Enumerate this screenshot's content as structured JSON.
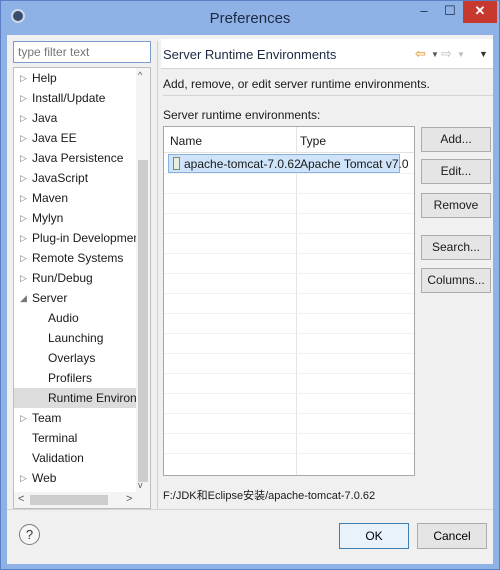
{
  "window": {
    "title": "Preferences",
    "minimize": "–",
    "maximize": "☐",
    "close": "✕"
  },
  "filter": {
    "placeholder": "type filter text"
  },
  "tree": [
    {
      "label": "Help",
      "arrow": "▷",
      "child": false
    },
    {
      "label": "Install/Update",
      "arrow": "▷",
      "child": false
    },
    {
      "label": "Java",
      "arrow": "▷",
      "child": false
    },
    {
      "label": "Java EE",
      "arrow": "▷",
      "child": false
    },
    {
      "label": "Java Persistence",
      "arrow": "▷",
      "child": false
    },
    {
      "label": "JavaScript",
      "arrow": "▷",
      "child": false
    },
    {
      "label": "Maven",
      "arrow": "▷",
      "child": false
    },
    {
      "label": "Mylyn",
      "arrow": "▷",
      "child": false
    },
    {
      "label": "Plug-in Development",
      "arrow": "▷",
      "child": false
    },
    {
      "label": "Remote Systems",
      "arrow": "▷",
      "child": false
    },
    {
      "label": "Run/Debug",
      "arrow": "▷",
      "child": false
    },
    {
      "label": "Server",
      "arrow": "◢",
      "child": false
    },
    {
      "label": "Audio",
      "arrow": "",
      "child": true
    },
    {
      "label": "Launching",
      "arrow": "",
      "child": true
    },
    {
      "label": "Overlays",
      "arrow": "",
      "child": true
    },
    {
      "label": "Profilers",
      "arrow": "",
      "child": true
    },
    {
      "label": "Runtime Environm",
      "arrow": "",
      "child": true,
      "selected": true
    },
    {
      "label": "Team",
      "arrow": "▷",
      "child": false
    },
    {
      "label": "Terminal",
      "arrow": "",
      "child": false
    },
    {
      "label": "Validation",
      "arrow": "",
      "child": false
    },
    {
      "label": "Web",
      "arrow": "▷",
      "child": false
    }
  ],
  "scroll": {
    "up": "^",
    "down": "v",
    "left": "<",
    "right": ">"
  },
  "page": {
    "title": "Server Runtime Environments",
    "description": "Add, remove, or edit server runtime environments.",
    "list_label": "Server runtime environments:",
    "nav": {
      "back": "⇦",
      "back_dd": "▼",
      "fwd": "⇨",
      "fwd_dd": "▼",
      "menu": "▼"
    },
    "columns": [
      "Name",
      "Type"
    ],
    "rows": [
      {
        "name": "apache-tomcat-7.0.62",
        "type": "Apache Tomcat v7.0"
      }
    ],
    "buttons": {
      "add": "Add...",
      "edit": "Edit...",
      "remove": "Remove",
      "search": "Search...",
      "columns": "Columns..."
    },
    "status_path": "F:/JDK和Eclipse安装/apache-tomcat-7.0.62"
  },
  "dialog": {
    "help": "?",
    "ok": "OK",
    "cancel": "Cancel"
  }
}
